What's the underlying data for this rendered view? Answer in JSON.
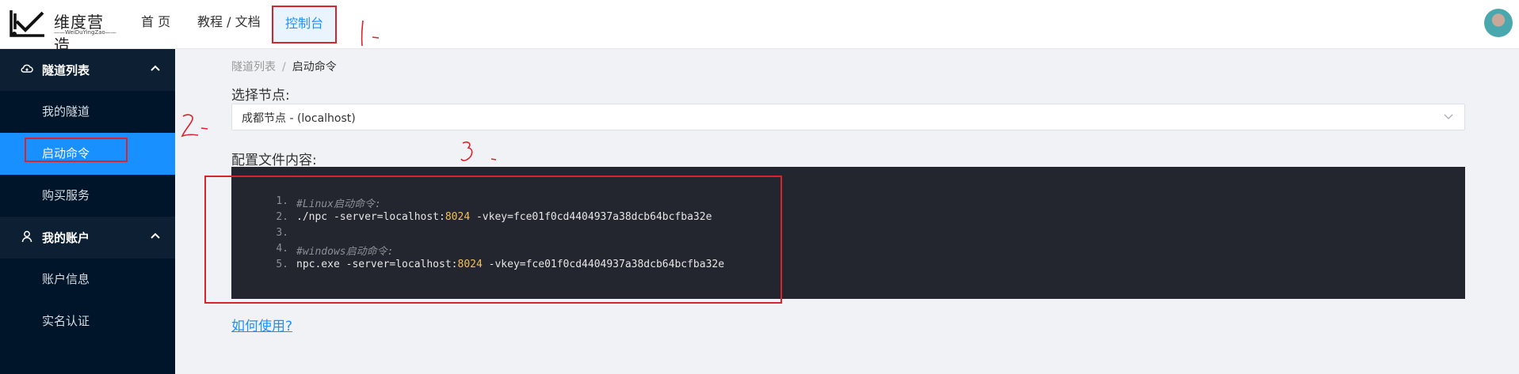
{
  "brand": {
    "name_cn": "维度营造",
    "name_en": "——WeiDuYingZao——"
  },
  "nav": {
    "home": "首 页",
    "docs": "教程 / 文档",
    "console": "控制台"
  },
  "sidebar": {
    "groups": [
      {
        "label": "隧道列表",
        "icon": "cloud-icon",
        "items": [
          "我的隧道",
          "启动命令",
          "购买服务"
        ],
        "active": "启动命令"
      },
      {
        "label": "我的账户",
        "icon": "user-icon",
        "items": [
          "账户信息",
          "实名认证"
        ]
      }
    ]
  },
  "breadcrumb": {
    "parent": "隧道列表",
    "separator": "/",
    "current": "启动命令"
  },
  "node_select": {
    "label": "选择节点:",
    "value": "成都节点 - (localhost)"
  },
  "config": {
    "label": "配置文件内容:",
    "lines": [
      {
        "num": "1.",
        "comment": "#Linux启动命令:"
      },
      {
        "num": "2.",
        "pre": "./npc -server=localhost:",
        "port": "8024",
        "post": " -vkey=fce01f0cd4404937a38dcb64bcfba32e"
      },
      {
        "num": "3.",
        "pre": ""
      },
      {
        "num": "4.",
        "comment": "#windows启动命令:"
      },
      {
        "num": "5.",
        "pre": "npc.exe -server=localhost:",
        "port": "8024",
        "post": " -vkey=fce01f0cd4404937a38dcb64bcfba32e"
      }
    ]
  },
  "help_link": "如何使用?",
  "colors": {
    "accent": "#1890ff",
    "sidebar_bg": "#001529",
    "code_bg": "#23262e",
    "annotation_red": "#d9232d"
  }
}
